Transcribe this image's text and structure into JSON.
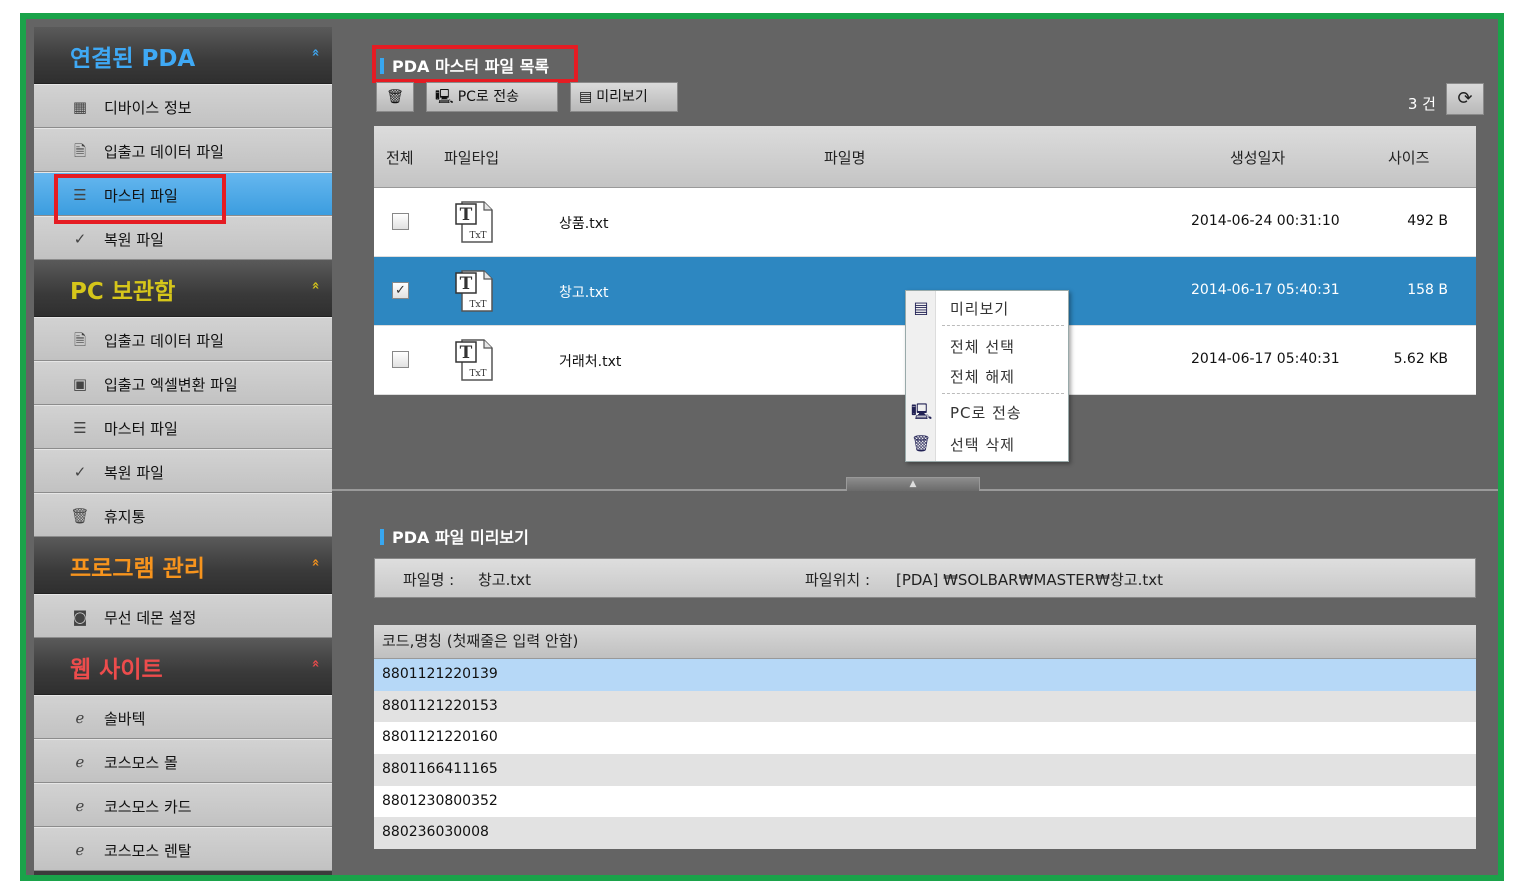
{
  "sidebar": {
    "sections": [
      {
        "title": "연결된 PDA",
        "color": "#3fa9f5",
        "arrow": "»",
        "items": [
          {
            "label": "디바이스 정보",
            "icon": "device-icon"
          },
          {
            "label": "입출고 데이터 파일",
            "icon": "file-data-icon"
          },
          {
            "label": "마스터 파일",
            "icon": "master-file-icon",
            "active": true
          },
          {
            "label": "복원 파일",
            "icon": "restore-file-icon"
          }
        ]
      },
      {
        "title": "PC 보관함",
        "color": "#d6c61a",
        "arrow": "»",
        "items": [
          {
            "label": "입출고 데이터 파일",
            "icon": "file-data-icon"
          },
          {
            "label": "입출고 엑셀변환 파일",
            "icon": "excel-file-icon"
          },
          {
            "label": "마스터 파일",
            "icon": "master-file-icon"
          },
          {
            "label": "복원 파일",
            "icon": "restore-file-icon"
          },
          {
            "label": "휴지통",
            "icon": "trash-icon"
          }
        ]
      },
      {
        "title": "프로그램 관리",
        "color": "#f7941d",
        "arrow": "»",
        "items": [
          {
            "label": "무선 데몬 설정",
            "icon": "wireless-icon"
          }
        ]
      },
      {
        "title": "웹 사이트",
        "color": "#ed4c4c",
        "arrow": "»",
        "items": [
          {
            "label": "솔바텍",
            "icon": "ie-icon"
          },
          {
            "label": "코스모스 몰",
            "icon": "ie-icon"
          },
          {
            "label": "코스모스 카드",
            "icon": "ie-icon"
          },
          {
            "label": "코스모스 렌탈",
            "icon": "ie-icon"
          }
        ]
      }
    ]
  },
  "main": {
    "title": "PDA 마스터 파일 목록",
    "toolbar": {
      "delete_icon": "trash-icon",
      "send_pc_label": "PC로 전송",
      "preview_label": "미리보기"
    },
    "count_label": "3 건",
    "table": {
      "headers": {
        "all": "전체",
        "type": "파일타입",
        "name": "파일명",
        "date": "생성일자",
        "size": "사이즈"
      },
      "rows": [
        {
          "checked": false,
          "type_text": "TxT",
          "name": "상품.txt",
          "date": "2014-06-24 00:31:10",
          "size": "492 B",
          "selected": false
        },
        {
          "checked": true,
          "type_text": "TxT",
          "name": "창고.txt",
          "date": "2014-06-17 05:40:31",
          "size": "158 B",
          "selected": true
        },
        {
          "checked": false,
          "type_text": "TxT",
          "name": "거래처.txt",
          "date": "2014-06-17 05:40:31",
          "size": "5.62 KB",
          "selected": false
        }
      ]
    },
    "context_menu": [
      {
        "label": "미리보기",
        "icon": "preview-icon"
      },
      {
        "label": "전체 선택",
        "icon": ""
      },
      {
        "label": "전체 해제",
        "icon": ""
      },
      {
        "label": "PC로 전송",
        "icon": "computer-icon"
      },
      {
        "label": "선택 삭제",
        "icon": "trash-icon"
      }
    ],
    "preview": {
      "title": "PDA 파일 미리보기",
      "file_name_label": "파일명 :",
      "file_name": "창고.txt",
      "file_path_label": "파일위치 :",
      "file_path": "[PDA] ₩SOLBAR₩MASTER₩창고.txt",
      "column_header": "코드,명칭 (첫째줄은 입력 안함)",
      "rows": [
        "8801121220139",
        "8801121220153",
        "8801121220160",
        "8801166411165",
        "8801230800352",
        "880236030008"
      ]
    }
  },
  "colors": {
    "frame": "#1aa34a",
    "highlight_box": "#e51c23",
    "selection": "#2d87c1",
    "accent": "#38a7f0"
  }
}
